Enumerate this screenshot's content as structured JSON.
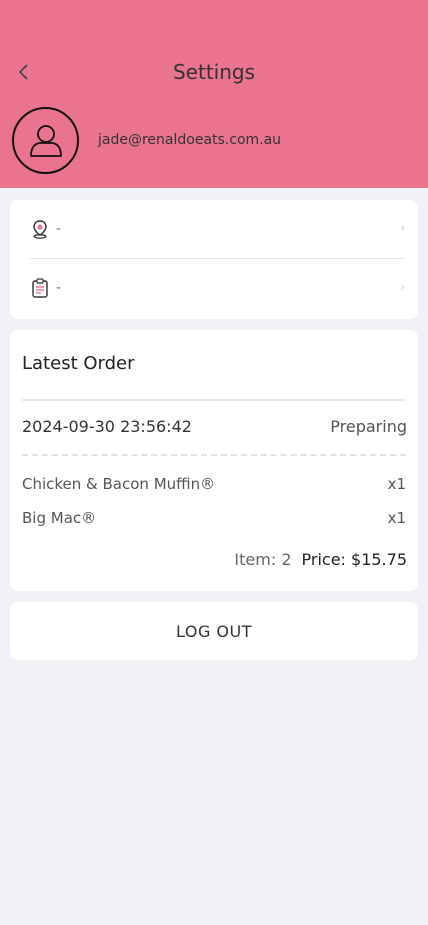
{
  "header": {
    "title": "Settings",
    "email": "jade@renaldoeats.com.au",
    "color": "#ea738d"
  },
  "info": {
    "address_value": "-",
    "orders_value": "-"
  },
  "order": {
    "title": "Latest Order",
    "datetime": "2024-09-30 23:56:42",
    "status": "Preparing",
    "items": [
      {
        "name": "Chicken & Bacon Muffin®",
        "qty": "x1"
      },
      {
        "name": "Big Mac®",
        "qty": "x1"
      }
    ],
    "item_count": "Item: 2",
    "price": "Price: $15.75"
  },
  "logout_label": "LOG OUT"
}
